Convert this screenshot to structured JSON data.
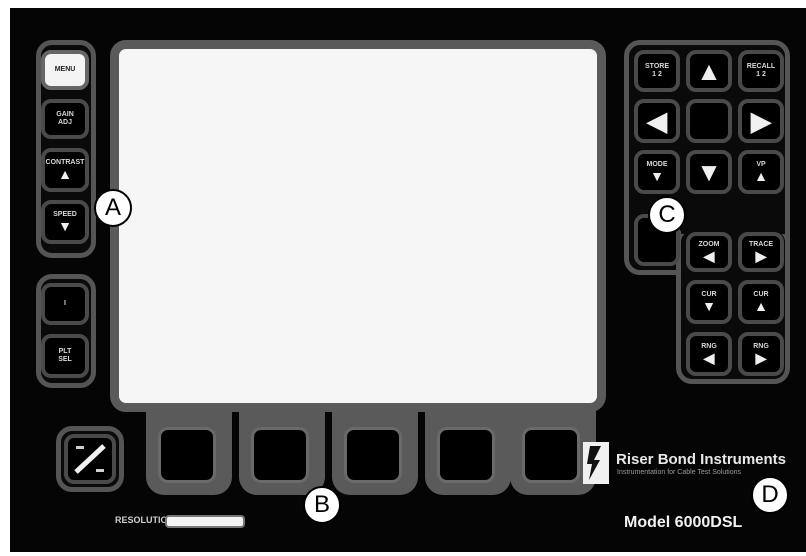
{
  "left_keys": {
    "menu": "MENU",
    "gain_label": "GAIN",
    "gain_sub": "ADJ",
    "contrast_label": "CONTRAST",
    "contrast_icon": "▲",
    "speed_label": "SPEED",
    "speed_icon": "▼",
    "key5": "I",
    "key6_line1": "PLT",
    "key6_line2": "SEL"
  },
  "right_keys": {
    "store": "STORE",
    "store_sub": "1 2",
    "up_arrow": "▲",
    "recall": "RECALL",
    "recall_sub": "1 2",
    "left_arrow": "◀",
    "right_arrow": "▶",
    "mode_label": "MODE",
    "down_arrow": "▼",
    "vp_label": "VP",
    "zoom_label": "ZOOM",
    "zoom_icon": "◀",
    "trace_label": "TRACE",
    "trace_icon": "▶",
    "cursor1_label": "CUR",
    "cursor1_icon": "▼",
    "cursor2_label": "CUR",
    "cursor2_icon": "▲",
    "range1_label": "RNG",
    "range1_icon": "◀",
    "range2_label": "RNG",
    "range2_icon": "▶"
  },
  "meter_label": "RESOLUTION",
  "brand_name": "Riser Bond Instruments",
  "tagline": "Instrumentation for Cable Test Solutions",
  "model_name": "Model 6000DSL",
  "callouts": {
    "a": "A",
    "b": "B",
    "c": "C",
    "d": "D"
  },
  "colors": {
    "panel_bg": "#050505",
    "key_border": "#4a4a4a",
    "group_border": "#555555",
    "screen_bg": "#f6f6f6"
  }
}
